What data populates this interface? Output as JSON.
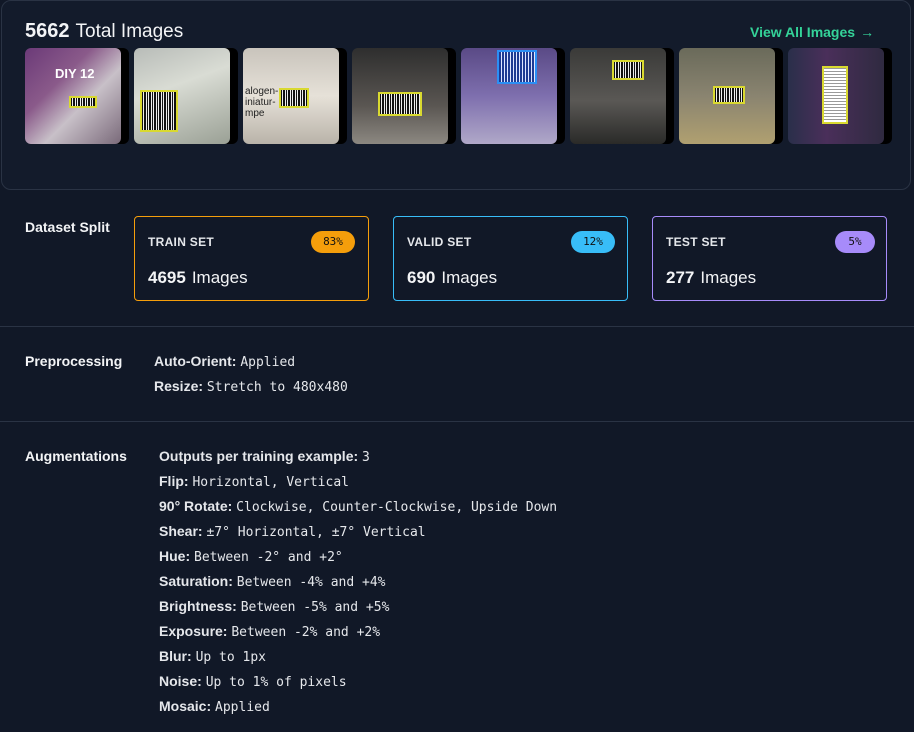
{
  "header": {
    "total_count": "5662",
    "total_label": "Total Images",
    "view_all_label": "View All Images",
    "view_all_arrow": "→"
  },
  "thumbnails": [
    {
      "label": "DIY 12"
    },
    {
      "label": ""
    },
    {
      "label": "alogen- iniatur- mpe"
    },
    {
      "label": ""
    },
    {
      "label": ""
    },
    {
      "label": ""
    },
    {
      "label": ""
    },
    {
      "label": ""
    }
  ],
  "dataset_split": {
    "label": "Dataset Split",
    "train": {
      "title": "TRAIN SET",
      "badge": "83%",
      "count": "4695",
      "unit": "Images",
      "color": "#f59e0b"
    },
    "valid": {
      "title": "VALID SET",
      "badge": "12%",
      "count": "690",
      "unit": "Images",
      "color": "#38bdf8"
    },
    "test": {
      "title": "TEST SET",
      "badge": "5%",
      "count": "277",
      "unit": "Images",
      "color": "#a78bfa"
    }
  },
  "preprocessing": {
    "label": "Preprocessing",
    "items": [
      {
        "key": "Auto-Orient:",
        "value": "Applied"
      },
      {
        "key": "Resize:",
        "value": "Stretch to 480x480"
      }
    ]
  },
  "augmentations": {
    "label": "Augmentations",
    "items": [
      {
        "key": "Outputs per training example:",
        "value": "3"
      },
      {
        "key": "Flip:",
        "value": "Horizontal, Vertical"
      },
      {
        "key": "90° Rotate:",
        "value": "Clockwise, Counter-Clockwise, Upside Down"
      },
      {
        "key": "Shear:",
        "value": "±7° Horizontal, ±7° Vertical"
      },
      {
        "key": "Hue:",
        "value": "Between -2° and +2°"
      },
      {
        "key": "Saturation:",
        "value": "Between -4% and +4%"
      },
      {
        "key": "Brightness:",
        "value": "Between -5% and +5%"
      },
      {
        "key": "Exposure:",
        "value": "Between -2% and +2%"
      },
      {
        "key": "Blur:",
        "value": "Up to 1px"
      },
      {
        "key": "Noise:",
        "value": "Up to 1% of pixels"
      },
      {
        "key": "Mosaic:",
        "value": "Applied"
      }
    ]
  }
}
